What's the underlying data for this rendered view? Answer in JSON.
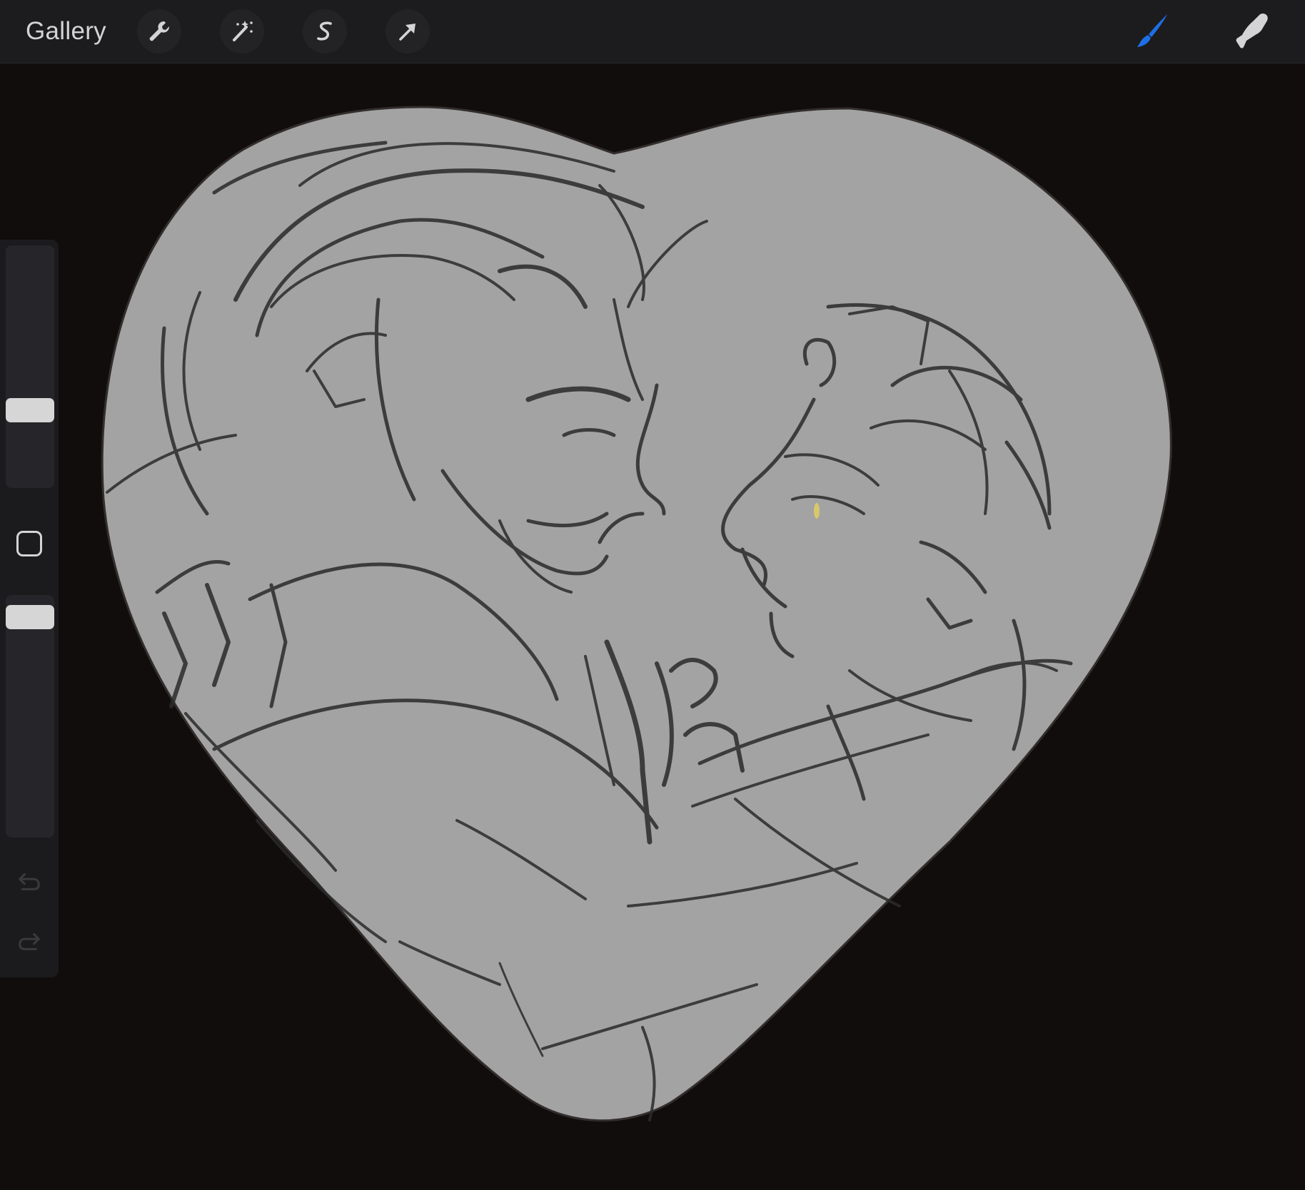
{
  "toolbar": {
    "gallery_label": "Gallery",
    "left_tools": [
      {
        "name": "actions",
        "icon": "wrench-icon"
      },
      {
        "name": "adjustments",
        "icon": "magic-wand-icon"
      },
      {
        "name": "selection",
        "icon": "selection-s-icon"
      },
      {
        "name": "transform",
        "icon": "arrow-cursor-icon"
      }
    ],
    "right_tools": [
      {
        "name": "brush",
        "icon": "brush-icon",
        "active": true
      },
      {
        "name": "smudge",
        "icon": "smudge-finger-icon",
        "active": false
      }
    ]
  },
  "sidebar": {
    "brush_size_level": 0.35,
    "opacity_level": 0.95,
    "modifier_icon": "square-modifier-icon",
    "undo_icon": "undo-icon",
    "redo_icon": "redo-icon"
  },
  "canvas": {
    "background_color": "#110d0d",
    "shape_fill": "#a3a3a4",
    "shape": "heart",
    "stroke_color": "#2b2b2b",
    "highlight_color": "#d8c86a"
  },
  "colors": {
    "accent": "#1e6fe6",
    "toolbar_bg": "#1c1c1e",
    "icon_color": "#d4d4d6"
  }
}
